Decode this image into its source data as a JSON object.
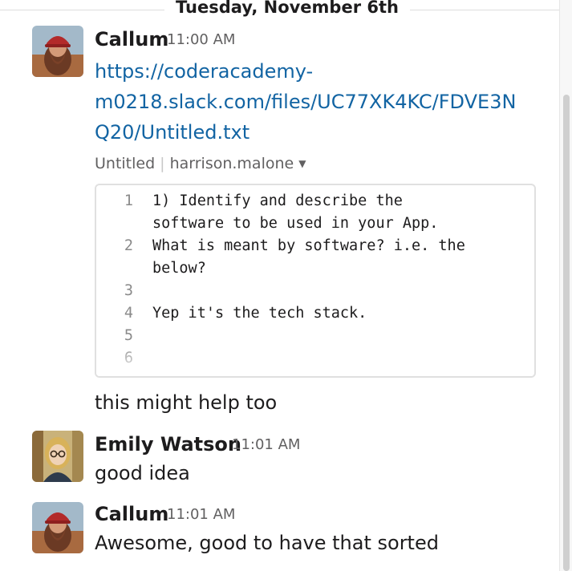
{
  "day_divider": "Tuesday, November 6th",
  "messages": [
    {
      "sender": "Callum",
      "time": "11:00 AM",
      "link_lines": [
        "https://coderacademy-",
        "m0218.slack.com/files/UC77XK4KC/FDVE3N",
        "Q20/Untitled.txt"
      ],
      "file": {
        "name": "Untitled",
        "owner": "harrison.malone"
      },
      "snippet": {
        "line_numbers": [
          "1",
          "2",
          "3",
          "4",
          "5",
          "6"
        ],
        "code_lines": [
          "1) Identify and describe the",
          "software to be used in your App.",
          "What is meant by software? i.e. the",
          "below?",
          "",
          "Yep it's the tech stack."
        ]
      },
      "text": "this might help too"
    },
    {
      "sender": "Emily Watson",
      "time": "11:01 AM",
      "text": "good idea"
    },
    {
      "sender": "Callum",
      "time": "11:01 AM",
      "text": "Awesome, good to have that sorted"
    }
  ],
  "icons": {
    "dropdown": "caret-down-icon",
    "avatar_callum": "avatar-photo-man-red-cap",
    "avatar_emily": "avatar-photo-woman-glasses"
  },
  "colors": {
    "link": "#1264a3",
    "muted": "#616061",
    "text": "#1d1c1d"
  }
}
